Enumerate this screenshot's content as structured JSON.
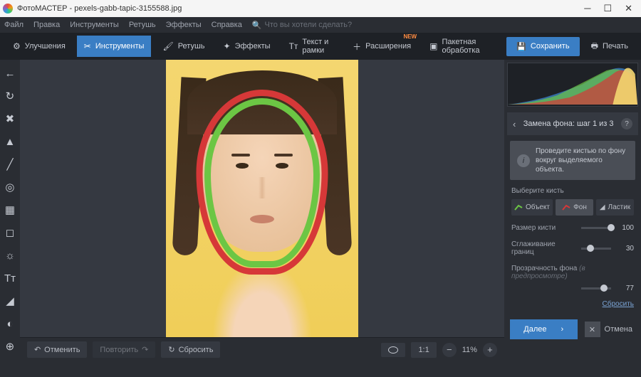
{
  "title": "ФотоМАСТЕР - pexels-gabb-tapic-3155588.jpg",
  "menu": {
    "file": "Файл",
    "edit": "Правка",
    "tools": "Инструменты",
    "retouch": "Ретушь",
    "effects": "Эффекты",
    "help": "Справка",
    "search": "Что вы хотели сделать?"
  },
  "tabs": {
    "enhance": "Улучшения",
    "tools": "Инструменты",
    "retouch": "Ретушь",
    "effects": "Эффекты",
    "text": "Текст и рамки",
    "extensions": "Расширения",
    "batch": "Пакетная обработка",
    "new": "NEW"
  },
  "buttons": {
    "save": "Сохранить",
    "print": "Печать"
  },
  "panel": {
    "title": "Замена фона: шаг 1 из 3",
    "info": "Проведите кистью по фону вокруг выделяемого объекта.",
    "brush_label": "Выберите кисть",
    "object": "Объект",
    "background": "Фон",
    "eraser": "Ластик",
    "size": "Размер кисти",
    "size_val": "100",
    "smooth": "Сглаживание границ",
    "smooth_val": "30",
    "opacity": "Прозрачность фона",
    "opacity_hint": "(в предпросмотре)",
    "opacity_val": "77",
    "reset": "Сбросить",
    "next": "Далее",
    "cancel": "Отмена"
  },
  "bottom": {
    "undo": "Отменить",
    "redo": "Повторить",
    "reset": "Сбросить",
    "ratio": "1:1",
    "zoom": "11%"
  }
}
